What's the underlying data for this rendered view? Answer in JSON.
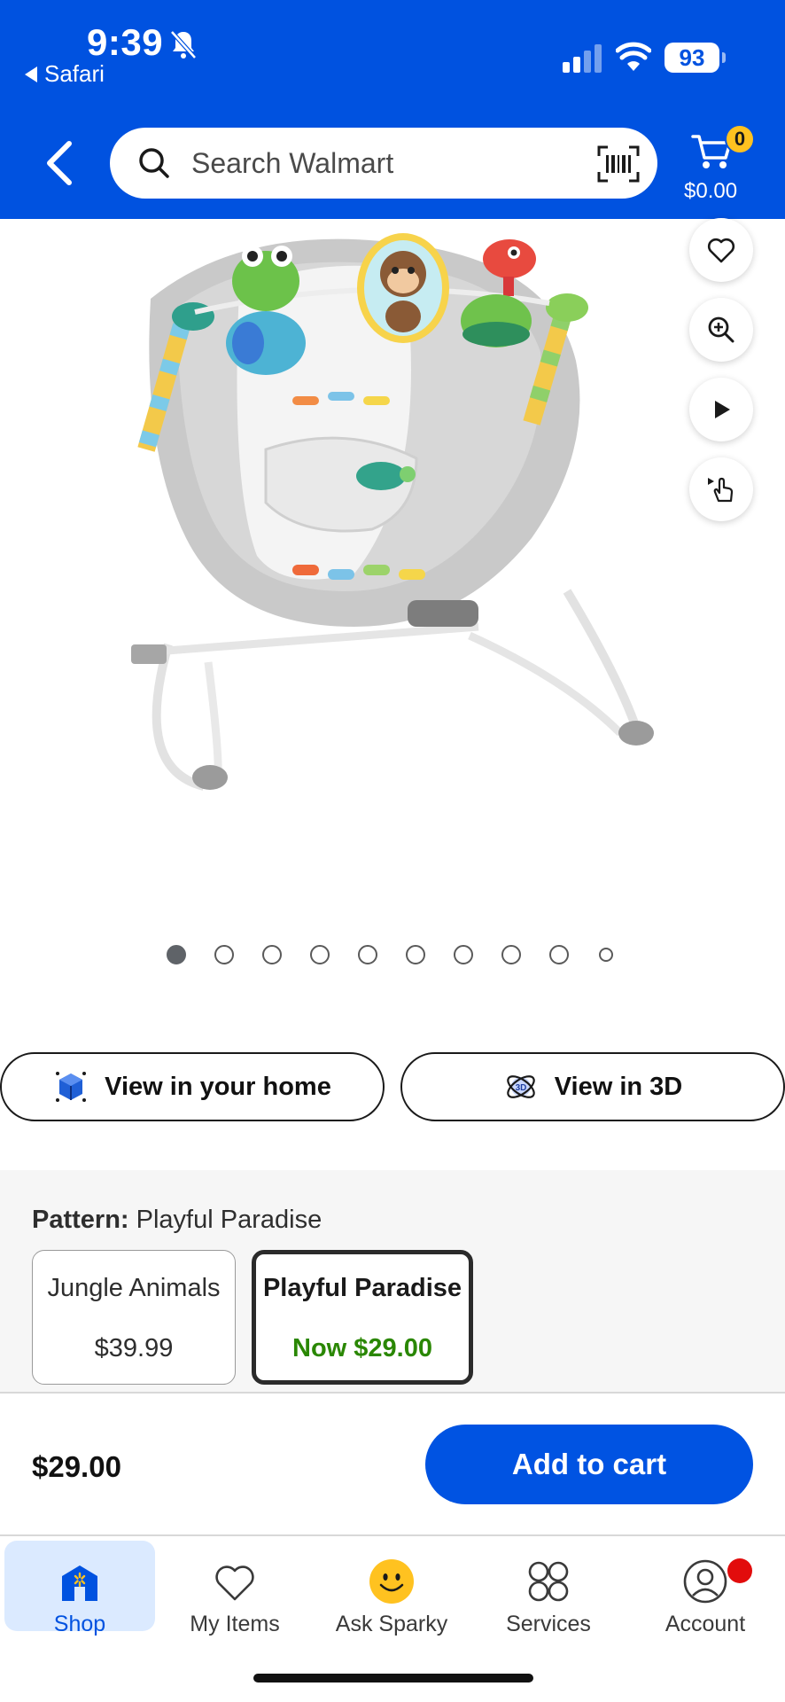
{
  "status_bar": {
    "time": "9:39",
    "back_app": "Safari",
    "battery": "93"
  },
  "header": {
    "search_placeholder": "Search Walmart",
    "cart_count": "0",
    "cart_total": "$0.00"
  },
  "carousel": {
    "dot_count": 10,
    "active_index": 0
  },
  "actions": {
    "view_home": "View in your home",
    "view_3d": "View in 3D"
  },
  "pattern": {
    "label": "Pattern:",
    "selected": "Playful Paradise",
    "options": [
      {
        "name": "Jungle Animals",
        "price": "$39.99"
      },
      {
        "name": "Playful Paradise",
        "price": "Now $29.00"
      }
    ]
  },
  "purchase": {
    "price": "$29.00",
    "add_to_cart": "Add to cart"
  },
  "tabbar": {
    "items": [
      {
        "label": "Shop"
      },
      {
        "label": "My Items"
      },
      {
        "label": "Ask Sparky"
      },
      {
        "label": "Services"
      },
      {
        "label": "Account"
      }
    ]
  },
  "colors": {
    "brand_blue": "#0052e0",
    "spark_yellow": "#ffc220",
    "sale_green": "#2a8703"
  }
}
